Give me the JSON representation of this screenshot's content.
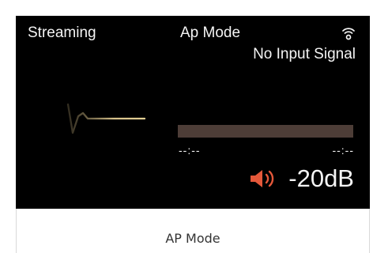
{
  "screen": {
    "source_label": "Streaming",
    "mode_label": "Ap Mode",
    "signal_status": "No Input Signal",
    "elapsed_time": "--:--",
    "total_time": "--:--",
    "progress": 0,
    "volume": "-20dB"
  },
  "footer": {
    "label": "AP Mode"
  },
  "icons": {
    "network": "wifi-icon",
    "waveform": "waveform-icon",
    "volume": "speaker-icon"
  },
  "colors": {
    "screen_background": "#000000",
    "text": "#f4f4f4",
    "speaker_accent": "#e4583a",
    "progress_track": "#4d3d37",
    "waveform": "#d6c18a"
  }
}
